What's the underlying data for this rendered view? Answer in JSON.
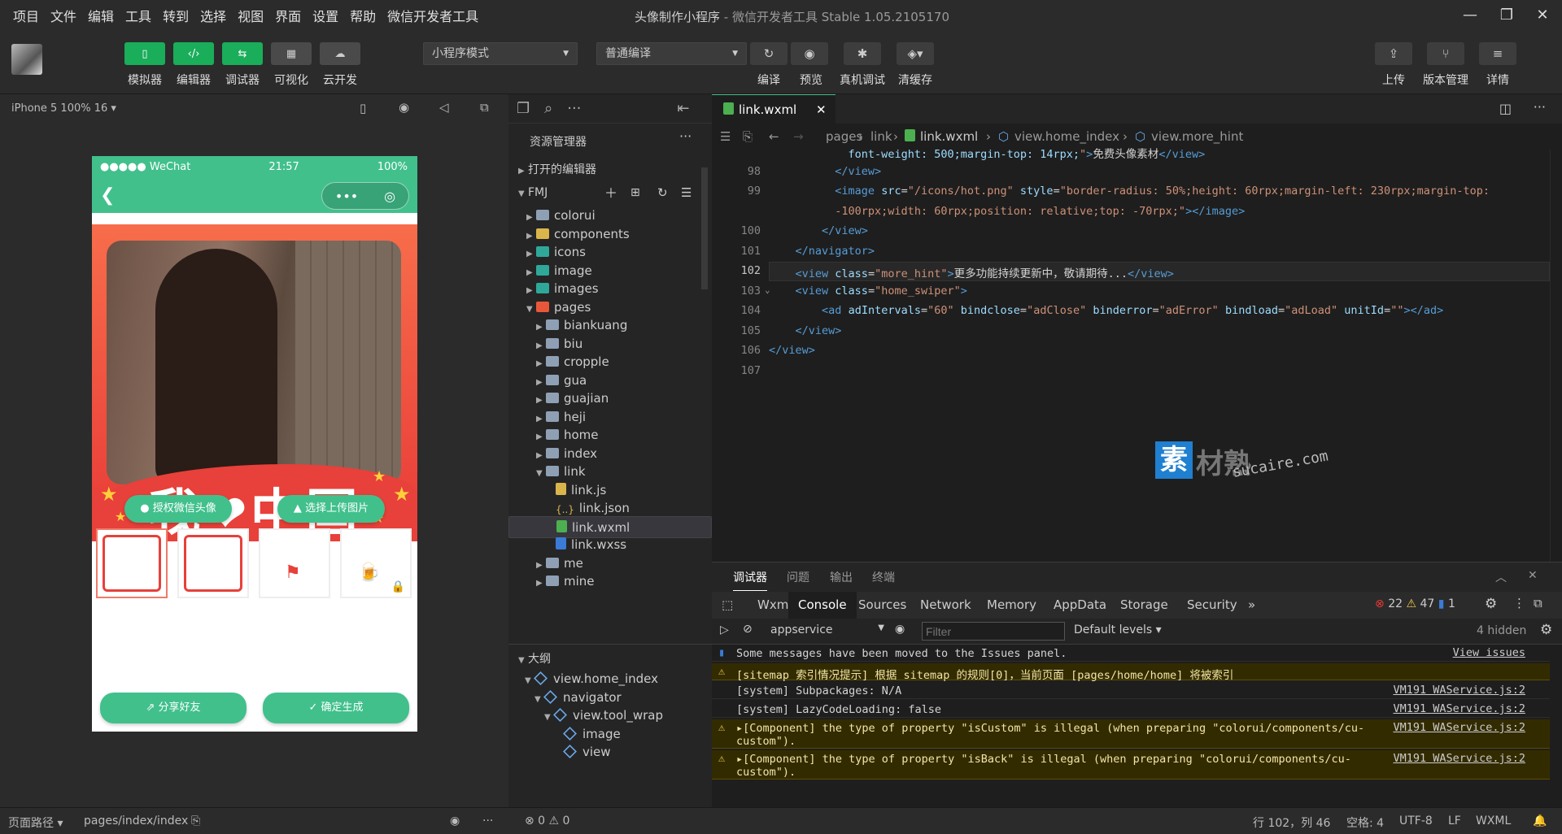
{
  "menu": [
    "项目",
    "文件",
    "编辑",
    "工具",
    "转到",
    "选择",
    "视图",
    "界面",
    "设置",
    "帮助",
    "微信开发者工具"
  ],
  "window_title": {
    "project": "头像制作小程序",
    "app": " - 微信开发者工具 Stable 1.05.2105170"
  },
  "toolbar": {
    "left_buttons": [
      {
        "label": "模拟器",
        "icon": "phone-icon"
      },
      {
        "label": "编辑器",
        "icon": "code-icon"
      },
      {
        "label": "调试器",
        "icon": "debug-icon"
      },
      {
        "label": "可视化",
        "icon": "layout-icon"
      },
      {
        "label": "云开发",
        "icon": "cloud-icon"
      }
    ],
    "mode_select": "小程序模式",
    "compile_select": "普通编译",
    "mid_buttons": [
      {
        "label": "编译",
        "icon": "refresh-icon"
      },
      {
        "label": "预览",
        "icon": "eye-icon"
      },
      {
        "label": "真机调试",
        "icon": "bug-icon"
      },
      {
        "label": "清缓存",
        "icon": "layers-icon"
      }
    ],
    "right_buttons": [
      {
        "label": "上传",
        "icon": "upload-icon"
      },
      {
        "label": "版本管理",
        "icon": "branch-icon"
      },
      {
        "label": "详情",
        "icon": "menu-icon"
      }
    ]
  },
  "simulator": {
    "device": "iPhone 5 100% 16 ▾",
    "status_carrier": "●●●●● WeChat",
    "status_time": "21:57",
    "status_battery": "100%",
    "slogan": "我❤中国",
    "btn_auth": "授权微信头像",
    "btn_upload": "选择上传图片",
    "btn_share": "分享好友",
    "btn_confirm": "确定生成"
  },
  "explorer": {
    "title": "资源管理器",
    "open_editors": "打开的编辑器",
    "root": "FMJ",
    "tree": [
      {
        "name": "colorui",
        "depth": 1,
        "icon": "folder",
        "arrow": "▶"
      },
      {
        "name": "components",
        "depth": 1,
        "icon": "folder-yel",
        "arrow": "▶"
      },
      {
        "name": "icons",
        "depth": 1,
        "icon": "folder-teal",
        "arrow": "▶"
      },
      {
        "name": "image",
        "depth": 1,
        "icon": "folder-teal",
        "arrow": "▶"
      },
      {
        "name": "images",
        "depth": 1,
        "icon": "folder-teal",
        "arrow": "▶"
      },
      {
        "name": "pages",
        "depth": 1,
        "icon": "folder-red",
        "arrow": "▼"
      },
      {
        "name": "biankuang",
        "depth": 2,
        "icon": "folder",
        "arrow": "▶"
      },
      {
        "name": "biu",
        "depth": 2,
        "icon": "folder",
        "arrow": "▶"
      },
      {
        "name": "cropple",
        "depth": 2,
        "icon": "folder",
        "arrow": "▶"
      },
      {
        "name": "gua",
        "depth": 2,
        "icon": "folder",
        "arrow": "▶"
      },
      {
        "name": "guajian",
        "depth": 2,
        "icon": "folder",
        "arrow": "▶"
      },
      {
        "name": "heji",
        "depth": 2,
        "icon": "folder",
        "arrow": "▶"
      },
      {
        "name": "home",
        "depth": 2,
        "icon": "folder",
        "arrow": "▶"
      },
      {
        "name": "index",
        "depth": 2,
        "icon": "folder",
        "arrow": "▶"
      },
      {
        "name": "link",
        "depth": 2,
        "icon": "folder",
        "arrow": "▼"
      },
      {
        "name": "link.js",
        "depth": 3,
        "icon": "js",
        "arrow": ""
      },
      {
        "name": "link.json",
        "depth": 3,
        "icon": "json",
        "arrow": ""
      },
      {
        "name": "link.wxml",
        "depth": 3,
        "icon": "wx",
        "arrow": "",
        "selected": true
      },
      {
        "name": "link.wxss",
        "depth": 3,
        "icon": "cs",
        "arrow": ""
      },
      {
        "name": "me",
        "depth": 2,
        "icon": "folder",
        "arrow": "▶"
      },
      {
        "name": "mine",
        "depth": 2,
        "icon": "folder",
        "arrow": "▶"
      }
    ],
    "outline_title": "大纲",
    "outline": [
      {
        "name": "view.home_index",
        "depth": 1,
        "arrow": "▼"
      },
      {
        "name": "navigator",
        "depth": 2,
        "arrow": "▼"
      },
      {
        "name": "view.tool_wrap",
        "depth": 3,
        "arrow": "▼"
      },
      {
        "name": "image",
        "depth": 4,
        "arrow": ""
      },
      {
        "name": "view",
        "depth": 4,
        "arrow": ""
      }
    ]
  },
  "editor": {
    "tab": "link.wxml",
    "breadcrumbs": [
      "pages",
      "link",
      "link.wxml",
      "view.home_index",
      "view.more_hint"
    ],
    "lines": [
      {
        "n": "",
        "html": "            <span class='at'>font-weight: 500;margin-top: 14rpx;</span><span class='st'>\"</span><span class='tg'>&gt;</span>免费头像素材<span class='tg'>&lt;/view&gt;</span>"
      },
      {
        "n": "98",
        "html": "          <span class='tg'>&lt;/view&gt;</span>"
      },
      {
        "n": "99",
        "html": "          <span class='tg'>&lt;image</span> <span class='at'>src</span>=<span class='st'>\"/icons/hot.png\"</span> <span class='at'>style</span>=<span class='st'>\"border-radius: 50%;height: 60rpx;margin-left: 230rpx;margin-top:</span>"
      },
      {
        "n": "",
        "html": "          <span class='st'>-100rpx;width: 60rpx;position: relative;top: -70rpx;\"</span><span class='tg'>&gt;&lt;/image&gt;</span>"
      },
      {
        "n": "100",
        "html": "        <span class='tg'>&lt;/view&gt;</span>"
      },
      {
        "n": "101",
        "html": "    <span class='tg'>&lt;/navigator&gt;</span>"
      },
      {
        "n": "102",
        "html": "    <span class='tg'>&lt;view</span> <span class='at'>class</span>=<span class='st'>\"more_hint\"</span><span class='tg'>&gt;</span>更多功能持续更新中，敬请期待...<span class='tg'>&lt;/view&gt;</span>"
      },
      {
        "n": "103",
        "html": "    <span class='tg'>&lt;view</span> <span class='at'>class</span>=<span class='st'>\"home_swiper\"</span><span class='tg'>&gt;</span>"
      },
      {
        "n": "104",
        "html": "        <span class='tg'>&lt;ad</span> <span class='at'>adIntervals</span>=<span class='st'>\"60\"</span> <span class='at'>bindclose</span>=<span class='st'>\"adClose\"</span> <span class='at'>binderror</span>=<span class='st'>\"adError\"</span> <span class='at'>bindload</span>=<span class='st'>\"adLoad\"</span> <span class='at'>unitId</span>=<span class='st'>\"\"</span><span class='tg'>&gt;&lt;/ad&gt;</span>"
      },
      {
        "n": "105",
        "html": "    <span class='tg'>&lt;/view&gt;</span>"
      },
      {
        "n": "106",
        "html": "<span class='tg'>&lt;/view&gt;</span>"
      },
      {
        "n": "107",
        "html": ""
      }
    ]
  },
  "watermark": {
    "glyph": "素",
    "text": "材熟",
    "url": "sucaire.com"
  },
  "debug": {
    "tabs": [
      "调试器",
      "问题",
      "输出",
      "终端"
    ],
    "devtools": [
      "Wxml",
      "Console",
      "Sources",
      "Network",
      "Memory",
      "AppData",
      "Storage",
      "Security",
      "»"
    ],
    "errors": "22",
    "warnings": "47",
    "info": "1",
    "context": "appservice",
    "filter_placeholder": "Filter",
    "levels": "Default levels ▾",
    "hidden": "4 hidden",
    "messages": [
      {
        "type": "info",
        "text": "Some messages have been moved to the Issues panel.",
        "src": "View issues"
      },
      {
        "type": "warn",
        "text": "[sitemap 索引情况提示] 根据 sitemap 的规则[0]，当前页面 [pages/home/home] 将被索引",
        "src": ""
      },
      {
        "type": "log",
        "text": "[system] Subpackages: N/A",
        "src": "VM191 WAService.js:2"
      },
      {
        "type": "log",
        "text": "[system] LazyCodeLoading: false",
        "src": "VM191 WAService.js:2"
      },
      {
        "type": "warn",
        "text": "▸[Component] the type of property \"isCustom\" is illegal (when preparing \"colorui/components/cu-\ncustom\").",
        "src": "VM191 WAService.js:2"
      },
      {
        "type": "warn",
        "text": "▸[Component] the type of property \"isBack\" is illegal (when preparing \"colorui/components/cu-\ncustom\").",
        "src": "VM191 WAService.js:2"
      }
    ]
  },
  "statusbar": {
    "path_label": "页面路径 ▾",
    "path": "pages/index/index",
    "problems": "⊗ 0 ⚠ 0",
    "cursor": "行 102，列 46",
    "spaces": "空格: 4",
    "encoding": "UTF-8",
    "eol": "LF",
    "lang": "WXML"
  }
}
